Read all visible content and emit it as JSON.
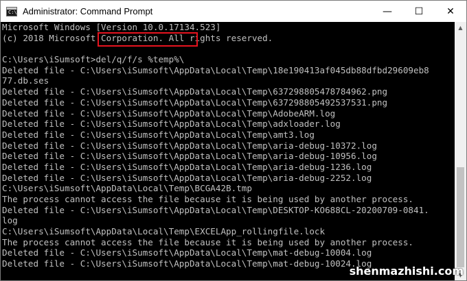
{
  "window": {
    "title": "Administrator: Command Prompt",
    "icon": "cmd-icon",
    "controls": {
      "minimize": "—",
      "maximize": "☐",
      "close": "✕"
    }
  },
  "console": {
    "lines": [
      "Microsoft Windows [Version 10.0.17134.523]",
      "(c) 2018 Microsoft Corporation. All rights reserved.",
      "",
      "C:\\Users\\iSumsoft>del/q/f/s %temp%\\",
      "Deleted file - C:\\Users\\iSumsoft\\AppData\\Local\\Temp\\18e190413af045db88dfbd29609eb8",
      "77.db.ses",
      "Deleted file - C:\\Users\\iSumsoft\\AppData\\Local\\Temp\\637298805478784962.png",
      "Deleted file - C:\\Users\\iSumsoft\\AppData\\Local\\Temp\\637298805492537531.png",
      "Deleted file - C:\\Users\\iSumsoft\\AppData\\Local\\Temp\\AdobeARM.log",
      "Deleted file - C:\\Users\\iSumsoft\\AppData\\Local\\Temp\\adxloader.log",
      "Deleted file - C:\\Users\\iSumsoft\\AppData\\Local\\Temp\\amt3.log",
      "Deleted file - C:\\Users\\iSumsoft\\AppData\\Local\\Temp\\aria-debug-10372.log",
      "Deleted file - C:\\Users\\iSumsoft\\AppData\\Local\\Temp\\aria-debug-10956.log",
      "Deleted file - C:\\Users\\iSumsoft\\AppData\\Local\\Temp\\aria-debug-1236.log",
      "Deleted file - C:\\Users\\iSumsoft\\AppData\\Local\\Temp\\aria-debug-2252.log",
      "C:\\Users\\iSumsoft\\AppData\\Local\\Temp\\BCGA42B.tmp",
      "The process cannot access the file because it is being used by another process.",
      "Deleted file - C:\\Users\\iSumsoft\\AppData\\Local\\Temp\\DESKTOP-KO688CL-20200709-0841.",
      "log",
      "C:\\Users\\iSumsoft\\AppData\\Local\\Temp\\EXCELApp_rollingfile.lock",
      "The process cannot access the file because it is being used by another process.",
      "Deleted file - C:\\Users\\iSumsoft\\AppData\\Local\\Temp\\mat-debug-10004.log",
      "Deleted file - C:\\Users\\iSumsoft\\AppData\\Local\\Temp\\mat-debug-10024.log"
    ]
  },
  "watermark": "shenmazhishi.com",
  "colors": {
    "console_bg": "#000000",
    "console_text": "#c0c0c0",
    "highlight": "#e8131f"
  }
}
